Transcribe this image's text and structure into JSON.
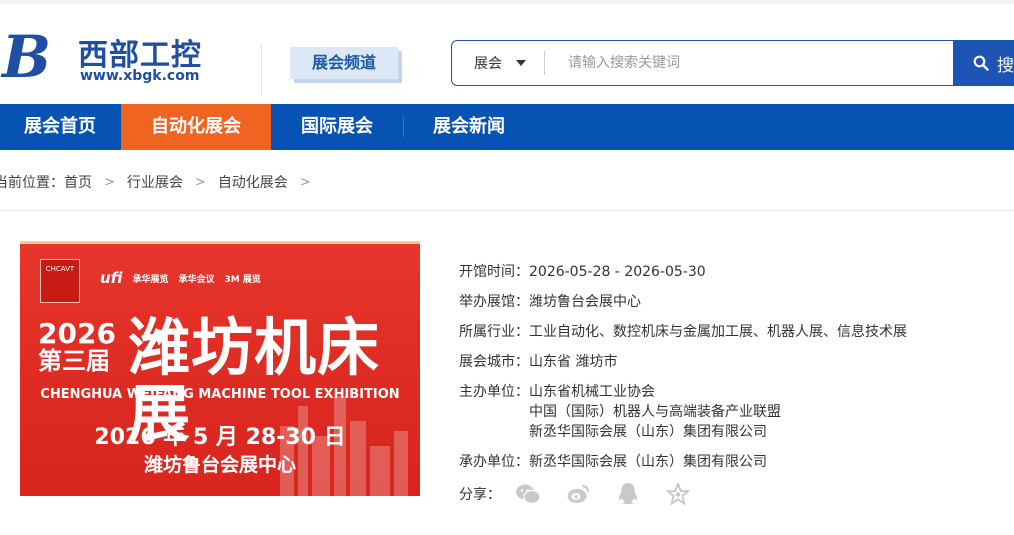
{
  "logo": {
    "mark": "B",
    "name": "西部工控",
    "url": "www.xbgk.com"
  },
  "channel": {
    "label": "展会频道"
  },
  "search": {
    "category": "展会",
    "placeholder": "请输入搜索关键词",
    "button": "搜"
  },
  "nav": {
    "items": [
      {
        "label": "展会首页",
        "active": false
      },
      {
        "label": "自动化展会",
        "active": true
      },
      {
        "label": "国际展会",
        "active": false
      },
      {
        "label": "展会新闻",
        "active": false
      }
    ]
  },
  "breadcrumb": {
    "label": "当前位置：",
    "items": [
      "首页",
      "行业展会",
      "自动化展会"
    ],
    "sep": ">"
  },
  "poster": {
    "badge": "CHCAVT",
    "logos": [
      "ufi",
      "承华展览",
      "承华会议",
      "3M 展览"
    ],
    "year": "2026",
    "session": "第三届",
    "title": "潍坊机床展",
    "english": "CHENGHUA WEIFANG MACHINE TOOL EXHIBITION",
    "date": "2026 年 5 月 28-30 日",
    "venue": "潍坊鲁台会展中心"
  },
  "info": {
    "open_time": {
      "label": "开馆时间：",
      "value": "2026-05-28 - 2026-05-30"
    },
    "venue": {
      "label": "举办展馆：",
      "value": "潍坊鲁台会展中心"
    },
    "industry": {
      "label": "所属行业：",
      "value": "工业自动化、数控机床与金属加工展、机器人展、信息技术展"
    },
    "city": {
      "label": "展会城市：",
      "value": "山东省 潍坊市"
    },
    "organizers": {
      "label": "主办单位：",
      "values": [
        "山东省机械工业协会",
        "中国（国际）机器人与高端装备产业联盟",
        "新丞华国际会展（山东）集团有限公司"
      ]
    },
    "undertaker": {
      "label": "承办单位：",
      "value": "新丞华国际会展（山东）集团有限公司"
    },
    "share": {
      "label": "分享：",
      "icons": [
        "wechat-icon",
        "weibo-icon",
        "qq-icon",
        "favorite-icon"
      ]
    }
  }
}
